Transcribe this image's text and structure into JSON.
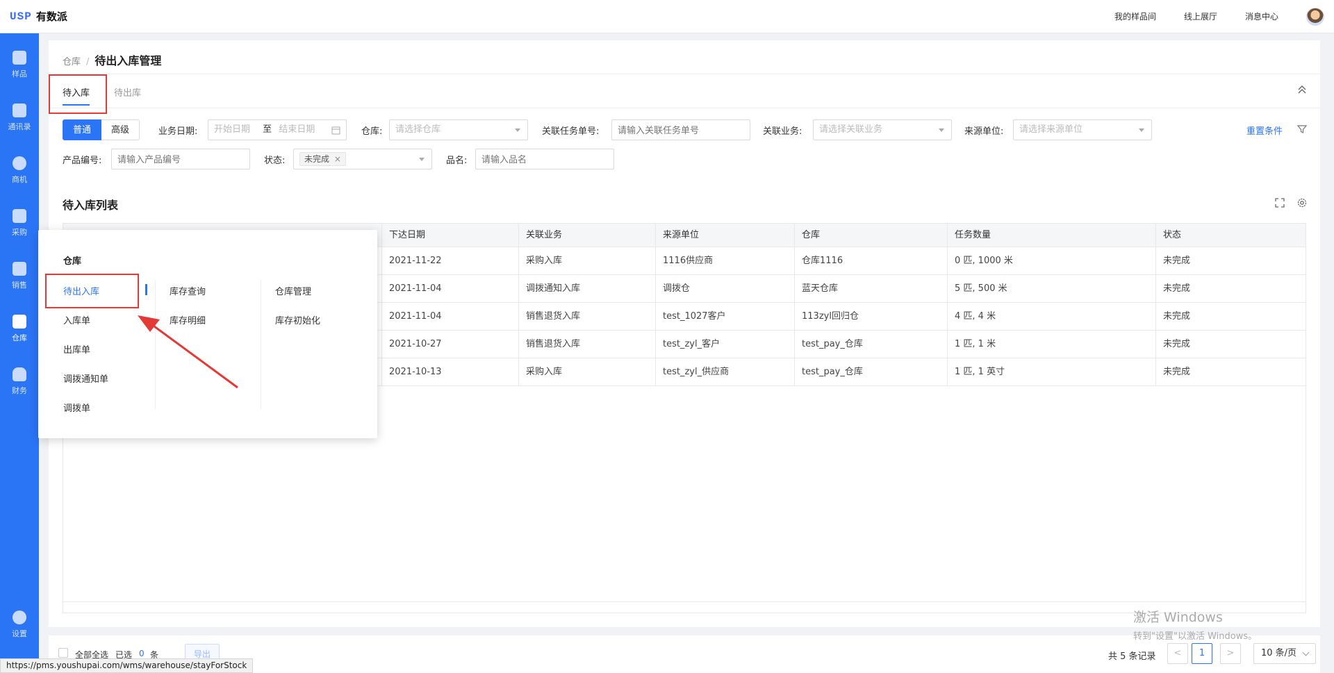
{
  "header": {
    "logo_mark": "USP",
    "logo_name": "有数派",
    "links": [
      "我的样品间",
      "线上展厅",
      "消息中心"
    ]
  },
  "sidebar": {
    "items": [
      {
        "label": "样品",
        "icon": "sample-icon"
      },
      {
        "label": "通讯录",
        "icon": "contacts-icon"
      },
      {
        "label": "商机",
        "icon": "opportunity-icon"
      },
      {
        "label": "采购",
        "icon": "purchase-icon"
      },
      {
        "label": "销售",
        "icon": "sales-icon"
      },
      {
        "label": "仓库",
        "icon": "warehouse-icon",
        "active": true
      },
      {
        "label": "财务",
        "icon": "finance-icon"
      },
      {
        "label": "设置",
        "icon": "settings-icon"
      }
    ]
  },
  "breadcrumb": {
    "parent": "仓库",
    "separator": "/",
    "current": "待出入库管理"
  },
  "tabs": [
    {
      "label": "待入库",
      "active": true
    },
    {
      "label": "待出库",
      "active": false
    }
  ],
  "filters": {
    "mode_normal": "普通",
    "mode_advanced": "高级",
    "biz_date_label": "业务日期:",
    "start_date_placeholder": "开始日期",
    "date_to": "至",
    "end_date_placeholder": "结束日期",
    "warehouse_label": "仓库:",
    "warehouse_placeholder": "请选择仓库",
    "task_no_label": "关联任务单号:",
    "task_no_placeholder": "请输入关联任务单号",
    "related_biz_label": "关联业务:",
    "related_biz_placeholder": "请选择关联业务",
    "source_unit_label": "来源单位:",
    "source_unit_placeholder": "请选择来源单位",
    "reset": "重置条件",
    "product_no_label": "产品编号:",
    "product_no_placeholder": "请输入产品编号",
    "status_label": "状态:",
    "status_tag": "未完成",
    "status_tag_close": "×",
    "product_name_label": "品名:",
    "product_name_placeholder": "请输入品名"
  },
  "list": {
    "title": "待入库列表",
    "columns": [
      "下达日期",
      "关联业务",
      "来源单位",
      "仓库",
      "任务数量",
      "状态"
    ],
    "rows": [
      [
        "2021-11-22",
        "采购入库",
        "1116供应商",
        "仓库1116",
        "0 匹, 1000 米",
        "未完成"
      ],
      [
        "2021-11-04",
        "调拨通知入库",
        "调拨仓",
        "蓝天仓库",
        "5 匹, 500 米",
        "未完成"
      ],
      [
        "2021-11-04",
        "销售退货入库",
        "test_1027客户",
        "113zyl回归仓",
        "4 匹, 4 米",
        "未完成"
      ],
      [
        "2021-10-27",
        "销售退货入库",
        "test_zyl_客户",
        "test_pay_仓库",
        "1 匹, 1 米",
        "未完成"
      ],
      [
        "2021-10-13",
        "采购入库",
        "test_zyl_供应商",
        "test_pay_仓库",
        "1 匹, 1 英寸",
        "未完成"
      ]
    ]
  },
  "footer": {
    "select_all": "全部全选",
    "selected": "已选",
    "selected_count": "0",
    "selected_unit": "条",
    "export": "导出",
    "total": "共 5 条记录",
    "prev": "<",
    "page": "1",
    "next": ">",
    "page_size": "10 条/页"
  },
  "menu": {
    "title": "仓库",
    "col1": [
      "待出入库",
      "入库单",
      "出库单",
      "调拨通知单",
      "调拨单"
    ],
    "col2": [
      "库存查询",
      "库存明细"
    ],
    "col3": [
      "仓库管理",
      "库存初始化"
    ]
  },
  "watermark": {
    "line1": "激活 Windows",
    "line2": "转到\"设置\"以激活 Windows。"
  },
  "status_url": "https://pms.youshupai.com/wms/warehouse/stayForStock",
  "colors": {
    "brand": "#2a74f6",
    "annotation": "#e53935"
  }
}
